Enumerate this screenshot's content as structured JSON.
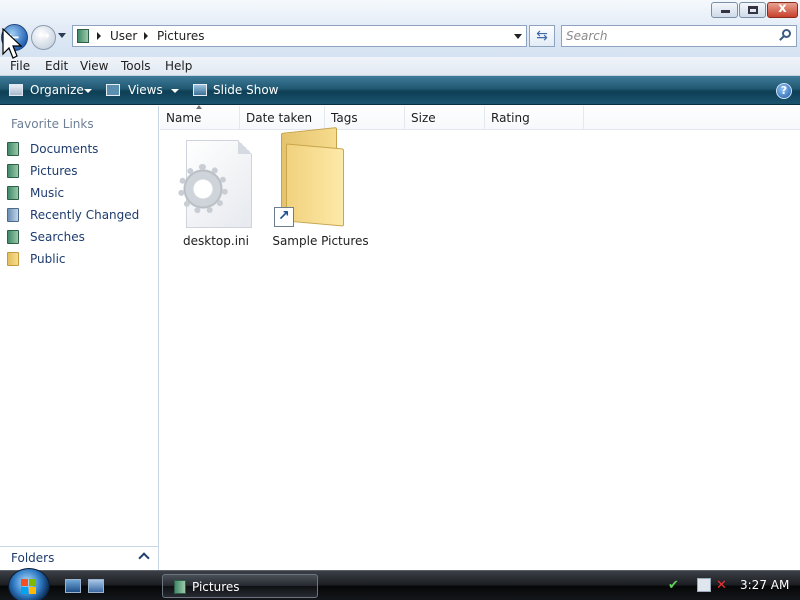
{
  "window": {
    "controls": {
      "minimize": "minimize",
      "maximize": "maximize",
      "close": "x"
    },
    "address": {
      "crumbs": [
        "User",
        "Pictures"
      ]
    },
    "search": {
      "placeholder": "Search"
    }
  },
  "menubar": {
    "items": [
      "File",
      "Edit",
      "View",
      "Tools",
      "Help"
    ]
  },
  "commandbar": {
    "organize": "Organize",
    "views": "Views",
    "slideshow": "Slide Show",
    "help": "?"
  },
  "sidebar": {
    "title": "Favorite Links",
    "links": [
      {
        "label": "Documents",
        "icon": "documents-icon"
      },
      {
        "label": "Pictures",
        "icon": "pictures-icon"
      },
      {
        "label": "Music",
        "icon": "music-icon"
      },
      {
        "label": "Recently Changed",
        "icon": "recently-changed-icon"
      },
      {
        "label": "Searches",
        "icon": "searches-icon"
      },
      {
        "label": "Public",
        "icon": "public-folder-icon"
      }
    ],
    "folders_label": "Folders"
  },
  "columns": [
    "Name",
    "Date taken",
    "Tags",
    "Size",
    "Rating"
  ],
  "files": [
    {
      "name": "desktop.ini",
      "icon": "settings-file-icon"
    },
    {
      "name": "Sample Pictures",
      "icon": "folder-shortcut-icon"
    }
  ],
  "taskbar": {
    "task_label": "Pictures",
    "clock": "3:27 AM"
  },
  "colors": {
    "command_bar": "#215872",
    "link_text": "#1e3c6e",
    "muted_title": "#6d7f95"
  }
}
